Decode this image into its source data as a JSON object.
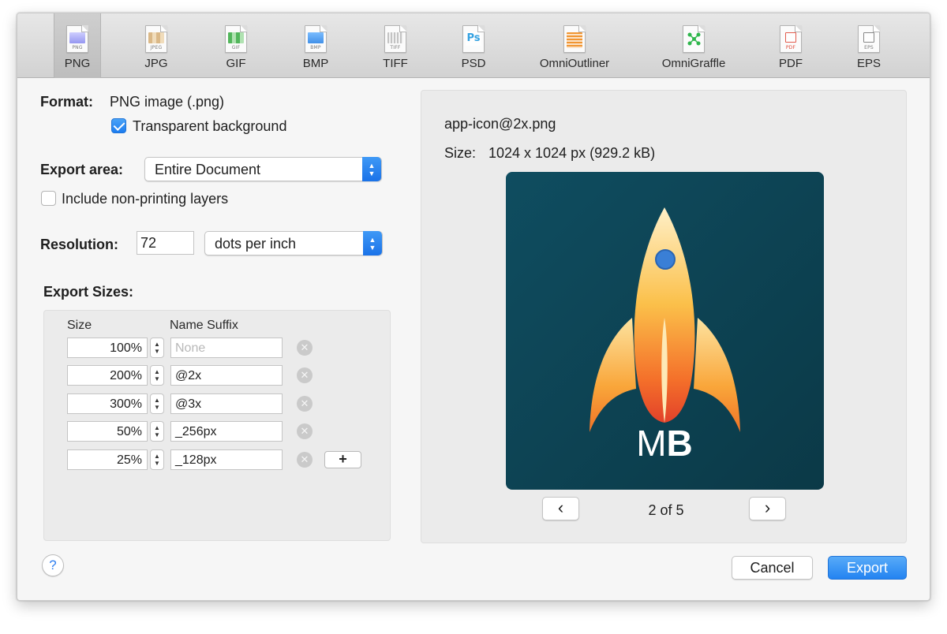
{
  "toolbar": {
    "formats": [
      {
        "label": "PNG",
        "tag": "PNG",
        "icon": "png-file-icon",
        "color": "#8a8cf0",
        "selected": true
      },
      {
        "label": "JPG",
        "tag": "JPEG",
        "icon": "jpg-file-icon",
        "color": "#c8a06a",
        "selected": false
      },
      {
        "label": "GIF",
        "tag": "GIF",
        "icon": "gif-file-icon",
        "color": "#3fae49",
        "selected": false
      },
      {
        "label": "BMP",
        "tag": "BMP",
        "icon": "bmp-file-icon",
        "color": "#3b8ee8",
        "selected": false
      },
      {
        "label": "TIFF",
        "tag": "TIFF",
        "icon": "tiff-file-icon",
        "color": "#8d8d8d",
        "selected": false
      },
      {
        "label": "PSD",
        "tag": "Ps",
        "icon": "psd-file-icon",
        "color": "#2a9fe0",
        "selected": false
      },
      {
        "label": "OmniOutliner",
        "tag": "",
        "icon": "omnioutliner-file-icon",
        "color": "#f08a1c",
        "selected": false
      },
      {
        "label": "OmniGraffle",
        "tag": "",
        "icon": "omnigraffle-file-icon",
        "color": "#3cc24a",
        "selected": false
      },
      {
        "label": "PDF",
        "tag": "PDF",
        "icon": "pdf-file-icon",
        "color": "#e04a3a",
        "selected": false
      },
      {
        "label": "EPS",
        "tag": "EPS",
        "icon": "eps-file-icon",
        "color": "#7b7b7b",
        "selected": false
      }
    ]
  },
  "format": {
    "label": "Format:",
    "value": "PNG image (.png)",
    "transparent_label": "Transparent background",
    "transparent_checked": true
  },
  "export_area": {
    "label": "Export area:",
    "value": "Entire Document",
    "include_nonprinting_label": "Include non-printing layers",
    "include_nonprinting_checked": false
  },
  "resolution": {
    "label": "Resolution:",
    "value": "72",
    "unit": "dots per inch"
  },
  "export_sizes": {
    "label": "Export Sizes:",
    "col_size": "Size",
    "col_suffix": "Name Suffix",
    "rows": [
      {
        "size": "100%",
        "suffix": "",
        "placeholder": "None"
      },
      {
        "size": "200%",
        "suffix": "@2x",
        "placeholder": ""
      },
      {
        "size": "300%",
        "suffix": "@3x",
        "placeholder": ""
      },
      {
        "size": "50%",
        "suffix": "_256px",
        "placeholder": ""
      },
      {
        "size": "25%",
        "suffix": "_128px",
        "placeholder": ""
      }
    ],
    "add_label": "+",
    "remove_label": "✕"
  },
  "preview": {
    "filename": "app-icon@2x.png",
    "size_label": "Size:",
    "size_value": "1024 x 1024 px (929.2 kB)",
    "image_text": "MB",
    "page": "2 of 5",
    "prev_label": "‹",
    "next_label": "›"
  },
  "buttons": {
    "help": "?",
    "cancel": "Cancel",
    "export": "Export"
  },
  "colors": {
    "accent": "#1f7ef1",
    "preview_bg": "#0f4a5c"
  }
}
